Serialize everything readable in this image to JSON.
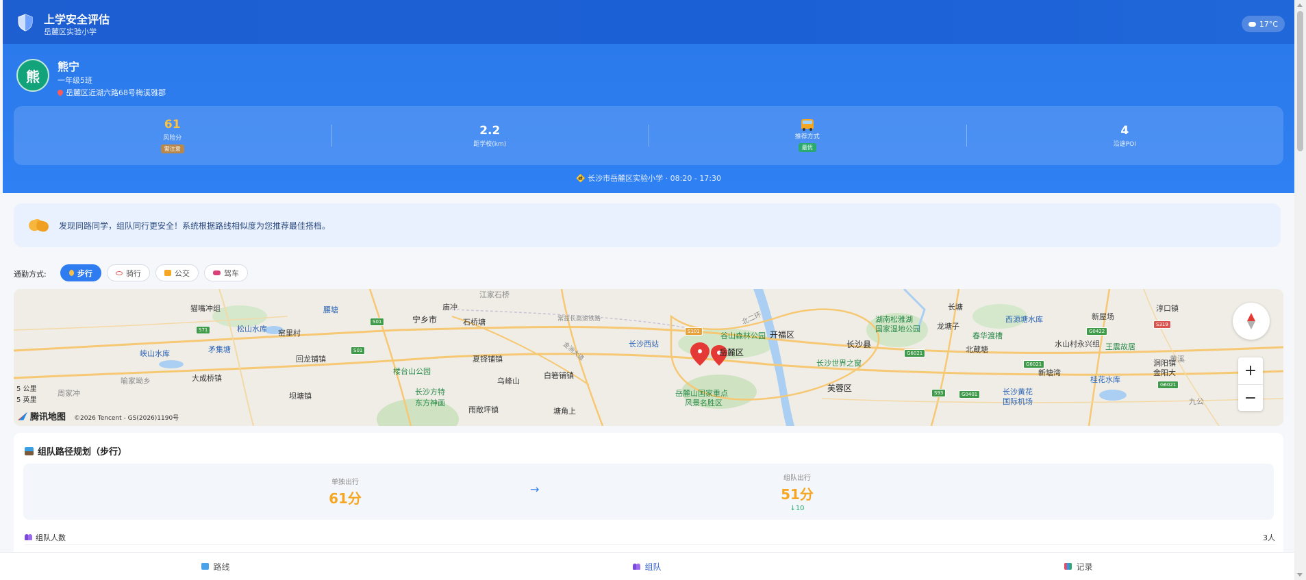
{
  "header": {
    "title": "上学安全评估",
    "subtitle": "岳麓区实验小学",
    "weather": "17°C"
  },
  "student": {
    "avatar_char": "熊",
    "name": "熊宁",
    "class": "一年级5班",
    "address": "岳麓区近湖六路68号梅溪雅郡"
  },
  "stats": {
    "risk_value": "61",
    "risk_label": "风险分",
    "risk_tag": "需注意",
    "distance_value": "2.2",
    "distance_label": "距学校(km)",
    "recommend_label": "推荐方式",
    "recommend_tag": "最优",
    "poi_value": "4",
    "poi_label": "沿途POI"
  },
  "schedule": "🚸 长沙市岳麓区实验小学 · 08:20 - 17:30",
  "notice": "发现同路同学，组队同行更安全！系统根据路线相似度为您推荐最佳搭档。",
  "modes": {
    "label": "通勤方式:",
    "items": [
      "步行",
      "骑行",
      "公交",
      "驾车"
    ],
    "active": 0
  },
  "map": {
    "labels": {
      "maozui": "猫嘴冲组",
      "songshan": "松山水库",
      "yaoli": "窑里村",
      "yaotang": "腰塘",
      "ningxiang": "宁乡市",
      "miaochong": "庙冲",
      "shiqiao": "石桥塘",
      "jiangjia": "江家石桥",
      "xiashanshui": "峡山水库",
      "maoji": "矛集塘",
      "huilong": "回龙铺镇",
      "daqiao": "大成桥镇",
      "baqiao": "坝塘镇",
      "huanjia": "喻家坳乡",
      "zhoujia": "周家冲",
      "loutai": "楼台山公园",
      "xiahuapu": "夏铎铺镇",
      "wufeng": "乌峰山",
      "baiyi": "白箬铺镇",
      "changsha_tefang": "长沙方特",
      "dongfang": "东方神画",
      "yuxi": "雨敞坪镇",
      "tangjiao": "塘角上",
      "changshaxi": "长沙西站",
      "gushan": "谷山森林公园",
      "yuelu_dist": "岳麓区",
      "kaifu": "开福区",
      "yuelushan": "岳麓山国家重点",
      "yuelushan2": "风景名胜区",
      "changsha_county": "长沙县",
      "shijie": "长沙世界之窗",
      "furong": "芙蓉区",
      "hunan_songya": "湖南松雅湖",
      "hunan_songya2": "国家湿地公园",
      "longbei": "龙塘子",
      "changtang": "长塘",
      "chunhua": "春华渡槽",
      "beisheng": "北蔵塘",
      "xiyuan": "西源塘水库",
      "shuishan": "水山村永兴组",
      "wangjia": "王震故居",
      "xintang": "新塘湾",
      "huanghua": "长沙黄花",
      "huanghua2": "国际机场",
      "guihua": "桂花水库",
      "chunkou": "淳口镇",
      "xinwu": "新屋场",
      "dongyang": "洞阳镇",
      "jingyang": "金阳大",
      "jiugong": "九公",
      "yuexi": "黄溪",
      "beierhuan": "北二环",
      "changzhang": "常益长高速铁路",
      "jinzhou": "金洲大道"
    },
    "shields": {
      "s71": "S71",
      "s01a": "S01",
      "s01b": "S01",
      "s101": "S101",
      "g0422": "G0422",
      "g6021a": "G6021",
      "g6021b": "G6021",
      "g6021c": "G6021",
      "g0401": "G0401",
      "s93": "S93",
      "s319": "S319"
    },
    "scale_km": "5 公里",
    "scale_mi": "5 英里",
    "logo": "腾讯地图",
    "copyright": "©2026 Tencent - GS(2026)1190号"
  },
  "team": {
    "title": "组队路径规划（步行）",
    "solo_label": "单独出行",
    "solo_value": "61分",
    "team_label": "组队出行",
    "team_value": "51分",
    "team_delta": "↓10",
    "arrow": "→",
    "size_label": "组队人数",
    "size_value": "3人"
  },
  "bottomnav": {
    "items": [
      "路线",
      "组队",
      "记录"
    ],
    "active": 1
  },
  "colors": {
    "primary": "#2f7bf0",
    "header_dark": "#1d5fd1",
    "risk_orange": "#f5a623",
    "success": "#2ba96f"
  }
}
